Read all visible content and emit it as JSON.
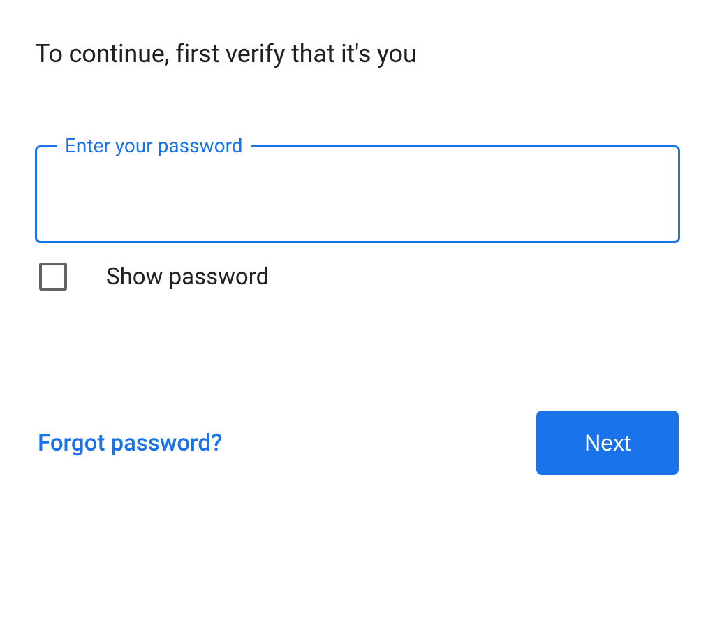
{
  "heading": "To continue, first verify that it's you",
  "password_field": {
    "label": "Enter your password",
    "value": ""
  },
  "show_password": {
    "label": "Show password",
    "checked": false
  },
  "forgot_link": "Forgot password?",
  "next_button": "Next",
  "colors": {
    "accent": "#1a73e8",
    "text_primary": "#202124",
    "border_muted": "#5f6368"
  }
}
